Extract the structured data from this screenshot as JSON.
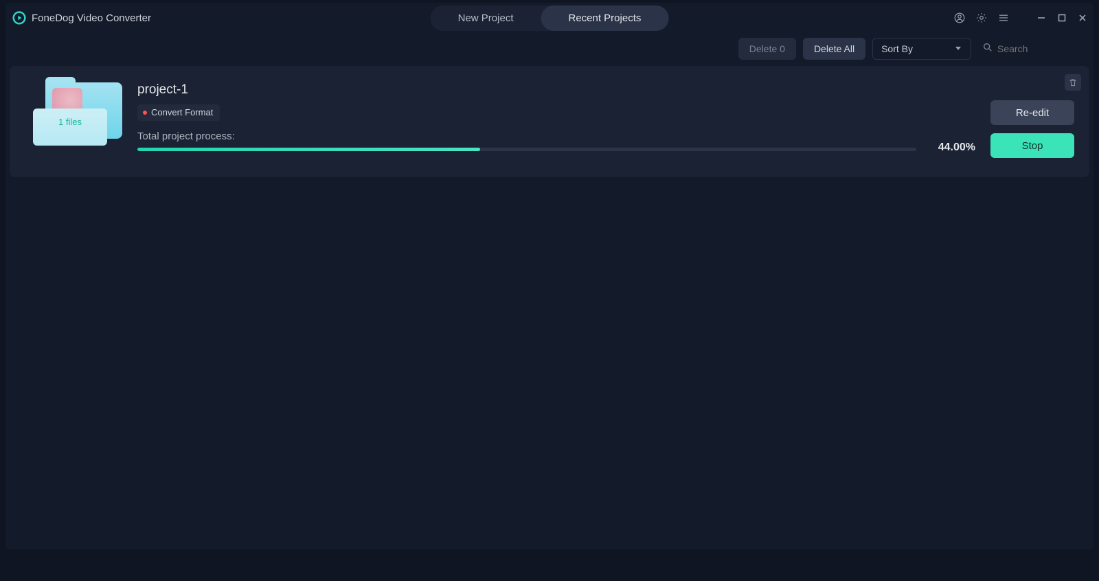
{
  "app": {
    "title": "FoneDog Video Converter"
  },
  "tabs": {
    "new_project": "New Project",
    "recent_projects": "Recent Projects"
  },
  "toolbar": {
    "delete_n": "Delete 0",
    "delete_all": "Delete All",
    "sort_by": "Sort By",
    "search_placeholder": "Search"
  },
  "project": {
    "title": "project-1",
    "badge": "Convert Format",
    "files_label": "1 files",
    "progress_label": "Total project process:",
    "progress_pct_text": "44.00%",
    "progress_pct_value": 44,
    "reedit": "Re-edit",
    "stop": "Stop"
  }
}
